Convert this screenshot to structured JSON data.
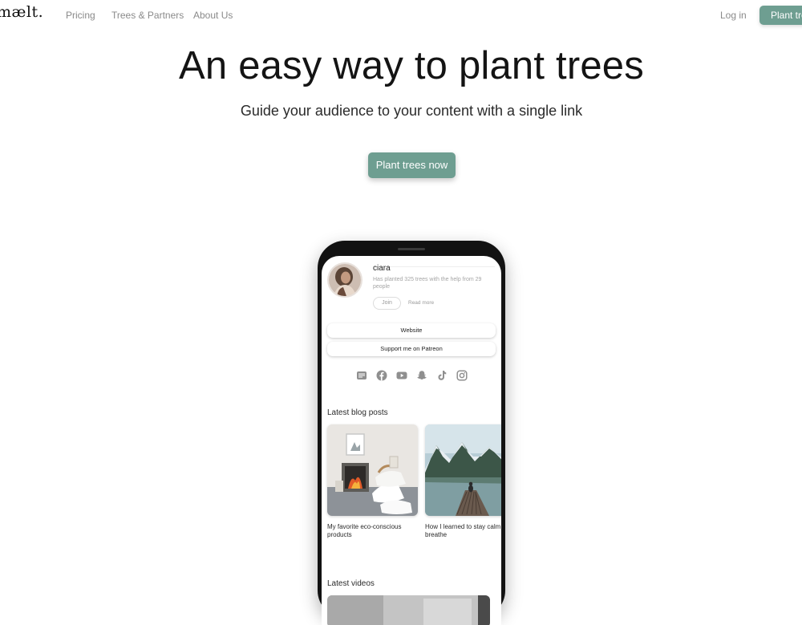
{
  "nav": {
    "logo": "mælt.",
    "links": [
      "Pricing",
      "Trees & Partners",
      "About Us"
    ],
    "login": "Log in",
    "cta": "Plant trees now"
  },
  "hero": {
    "title": "An easy way to plant trees",
    "subtitle": "Guide your audience to your content with a single link",
    "cta": "Plant trees now"
  },
  "phone": {
    "profile": {
      "name": "ciara",
      "description": "Has planted 325 trees with the help from 29 people",
      "join": "Join",
      "read_more": "Read more"
    },
    "links": [
      "Website",
      "Support me on Patreon"
    ],
    "socials": [
      "substack-icon",
      "facebook-icon",
      "youtube-icon",
      "snapchat-icon",
      "tiktok-icon",
      "instagram-icon"
    ],
    "blog_label": "Latest blog posts",
    "blog_posts": [
      {
        "title": "My favorite eco-conscious products"
      },
      {
        "title": "How I learned to stay calm and breathe"
      }
    ],
    "videos_label": "Latest videos"
  },
  "colors": {
    "accent": "#6e9e91",
    "nav_text": "#8a8a8a"
  }
}
